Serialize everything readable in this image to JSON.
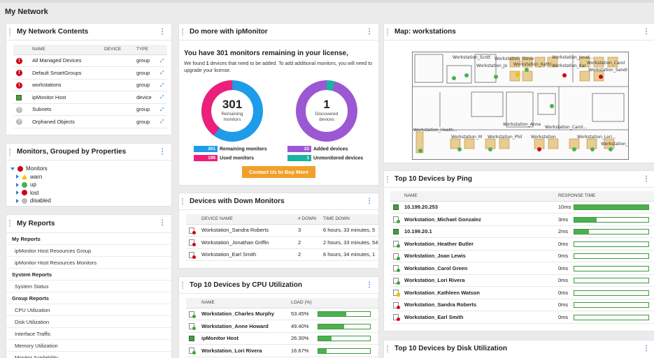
{
  "page": {
    "title": "My Network"
  },
  "colors": {
    "accent": "#2f7fd6",
    "ok": "#4caf50",
    "critical": "#d0021b",
    "warning": "#f2c200",
    "pink": "#ec1f7b",
    "blue": "#1e9be9",
    "purple": "#9c58d2",
    "teal": "#1bb3a1",
    "orange": "#f0a02a"
  },
  "network_contents": {
    "title": "My Network Contents",
    "columns": [
      "NAME",
      "DEVICE",
      "TYPE"
    ],
    "rows": [
      {
        "icon": "critical-icon",
        "name": "All Managed Devices",
        "device": "",
        "type": "group"
      },
      {
        "icon": "critical-icon",
        "name": "Default SmartGroups",
        "device": "",
        "type": "group"
      },
      {
        "icon": "critical-icon",
        "name": "workstations",
        "device": "",
        "type": "group"
      },
      {
        "icon": "host-icon",
        "name": "ipMonitor Host",
        "device": "",
        "type": "device"
      },
      {
        "icon": "unknown-icon",
        "name": "Subnets",
        "device": "",
        "type": "group"
      },
      {
        "icon": "unknown-icon",
        "name": "Orphaned Objects",
        "device": "",
        "type": "group"
      }
    ]
  },
  "grouped": {
    "title": "Monitors, Grouped by Properties",
    "root": "Monitors",
    "items": [
      "warn",
      "up",
      "lost",
      "disabled"
    ]
  },
  "reports": {
    "title": "My Reports",
    "rows": [
      {
        "label": "My Reports",
        "section": true
      },
      {
        "label": "ipMonitor Host Resources Group",
        "section": false
      },
      {
        "label": "ipMonitor Host Resources Monitors",
        "section": false
      },
      {
        "label": "System Reports",
        "section": true
      },
      {
        "label": "System Status",
        "section": false
      },
      {
        "label": "Group Reports",
        "section": true
      },
      {
        "label": "CPU Utilization",
        "section": false
      },
      {
        "label": "Disk Utilization",
        "section": false
      },
      {
        "label": "Interface Traffic",
        "section": false
      },
      {
        "label": "Memory Utilization",
        "section": false
      },
      {
        "label": "Monitor Availability",
        "section": false
      }
    ]
  },
  "do_more": {
    "title": "Do more with ipMonitor",
    "headline": "You have 301 monitors remaining in your license,",
    "body_pre": "We found ",
    "body_count": "1",
    "body_post": " devices that need to be added. To add additional monitors, you will need to upgrade your license.",
    "donut1": {
      "value": "301",
      "label1": "Remaining",
      "label2": "monitors",
      "remaining": 301,
      "used": 199
    },
    "donut2": {
      "value": "1",
      "label1": "Discovered",
      "label2": "devices",
      "added": 22,
      "unmonitored": 1
    },
    "legend": [
      {
        "count": "301",
        "label": "Remaining monitors"
      },
      {
        "count": "199",
        "label": "Used monitors"
      },
      {
        "count": "22",
        "label": "Added devices"
      },
      {
        "count": "1",
        "label": "Unmonitored devices"
      }
    ],
    "button": "Contact Us to Buy More"
  },
  "down_monitors": {
    "title": "Devices with Down Monitors",
    "columns": [
      "DEVICE NAME",
      "# DOWN",
      "TIME DOWN"
    ],
    "rows": [
      {
        "name": "Workstation_Sandra Roberts",
        "down": "3",
        "time": "6 hours, 33 minutes, 5"
      },
      {
        "name": "Workstation_Jonathan Griffin",
        "down": "2",
        "time": "2 hours, 33 minutes, 54"
      },
      {
        "name": "Workstation_Earl Smith",
        "down": "2",
        "time": "6 hours, 34 minutes, 1"
      }
    ]
  },
  "cpu": {
    "title": "Top 10 Devices by CPU Utilization",
    "columns": [
      "NAME",
      "LOAD (%)"
    ],
    "rows": [
      {
        "name": "Workstation_Charles Murphy",
        "value": "53.45%",
        "pct": 53.45
      },
      {
        "name": "Workstation_Anne Howard",
        "value": "49.40%",
        "pct": 49.4
      },
      {
        "name": "ipMonitor Host",
        "value": "26.30%",
        "pct": 26.3
      },
      {
        "name": "Workstation_Lori Rivera",
        "value": "16.67%",
        "pct": 16.67
      }
    ]
  },
  "map": {
    "title": "Map: workstations",
    "labels": [
      "Workstation_Scott",
      "Workstation_Steve",
      "Workstation_Jonat...",
      "Workstation_Carol",
      "Workstation_Jo",
      "Workstation_Kathl",
      "Workstation_Kar",
      "Workstation_Sandr",
      "Workstation_Anne",
      "Workstation_Carol...",
      "Workstation_Heath...",
      "Workstation_M",
      "Workstation_Phil",
      "Workstation",
      "Workstation_Lori...",
      "Workstation_Lori"
    ]
  },
  "ping": {
    "title": "Top 10 Devices by Ping",
    "columns": [
      "NAME",
      "RESPONSE TIME"
    ],
    "rows": [
      {
        "name": "10.199.20.253",
        "value": "10ms",
        "pct": 100,
        "icon": "host-icon"
      },
      {
        "name": "Workstation_Michael Gonzalez",
        "value": "3ms",
        "pct": 30,
        "icon": "ws-up-icon"
      },
      {
        "name": "10.199.20.1",
        "value": "2ms",
        "pct": 20,
        "icon": "host-icon"
      },
      {
        "name": "Workstation_Heather Butler",
        "value": "0ms",
        "pct": 0,
        "icon": "ws-up-icon"
      },
      {
        "name": "Workstation_Joan Lewis",
        "value": "0ms",
        "pct": 0,
        "icon": "ws-up-icon"
      },
      {
        "name": "Workstation_Carol Green",
        "value": "0ms",
        "pct": 0,
        "icon": "ws-up-icon"
      },
      {
        "name": "Workstation_Lori Rivera",
        "value": "0ms",
        "pct": 0,
        "icon": "ws-up-icon"
      },
      {
        "name": "Workstation_Kathleen Watson",
        "value": "0ms",
        "pct": 0,
        "icon": "ws-warn-icon"
      },
      {
        "name": "Workstation_Sandra Roberts",
        "value": "0ms",
        "pct": 0,
        "icon": "ws-down-icon"
      },
      {
        "name": "Workstation_Earl Smith",
        "value": "0ms",
        "pct": 0,
        "icon": "ws-down-icon"
      }
    ]
  },
  "disk": {
    "title": "Top 10 Devices by Disk Utilization"
  }
}
